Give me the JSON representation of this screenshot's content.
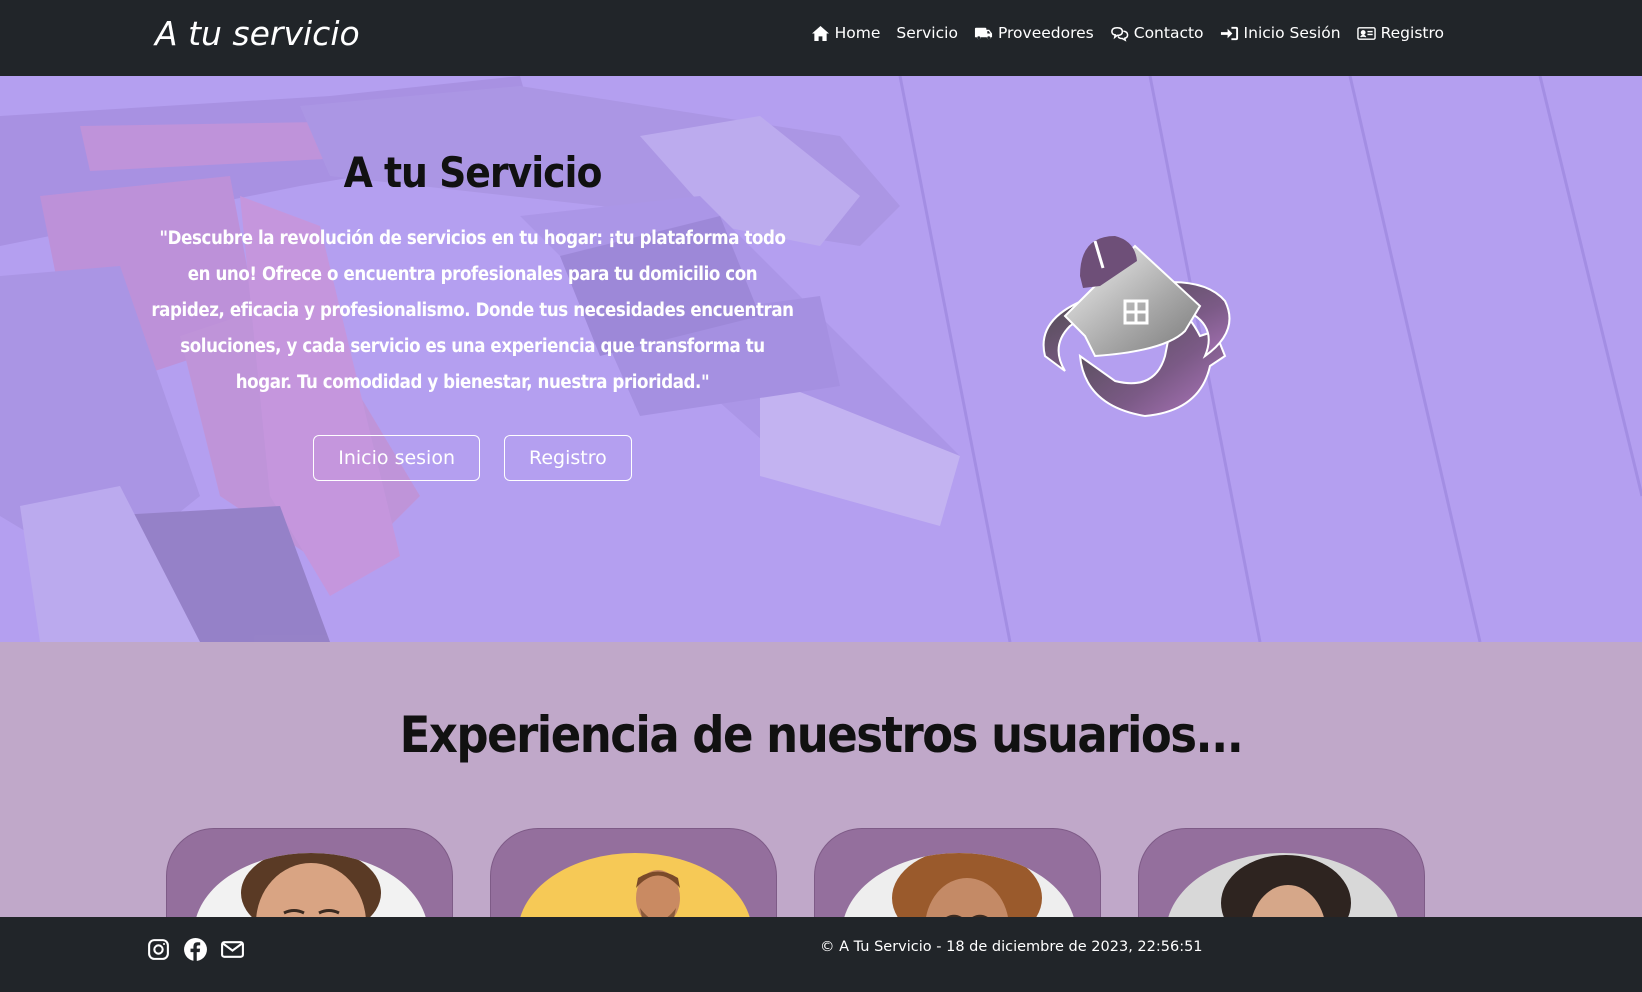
{
  "navbar": {
    "brand": "A tu servicio",
    "items": [
      {
        "label": "Home",
        "icon": "home-icon"
      },
      {
        "label": "Servicio",
        "icon": ""
      },
      {
        "label": "Proveedores",
        "icon": "truck-icon"
      },
      {
        "label": "Contacto",
        "icon": "chat-icon"
      },
      {
        "label": "Inicio Sesión",
        "icon": "login-icon"
      },
      {
        "label": "Registro",
        "icon": "id-card-icon"
      }
    ]
  },
  "hero": {
    "title": "A tu Servicio",
    "quote": "\"Descubre la revolución de servicios en tu hogar: ¡tu plataforma todo en uno! Ofrece o encuentra profesionales para tu domicilio con rapidez, eficacia y profesionalismo. Donde tus necesidades encuentran soluciones, y cada servicio es una experiencia que transforma tu hogar. Tu comodidad y bienestar, nuestra prioridad.\"",
    "login_button": "Inicio sesion",
    "register_button": "Registro"
  },
  "testimonials": {
    "title": "Experiencia de nuestros usuarios..."
  },
  "footer": {
    "social_icons": [
      "instagram-icon",
      "facebook-icon",
      "envelope-icon"
    ],
    "copyright": "© A Tu Servicio -  18 de diciembre de 2023, 22:56:51"
  },
  "colors": {
    "navbar_bg": "#212529",
    "hero_overlay": "#b49ff0",
    "section_bg": "#c0a8c9",
    "card_bg": "#946f9d"
  }
}
